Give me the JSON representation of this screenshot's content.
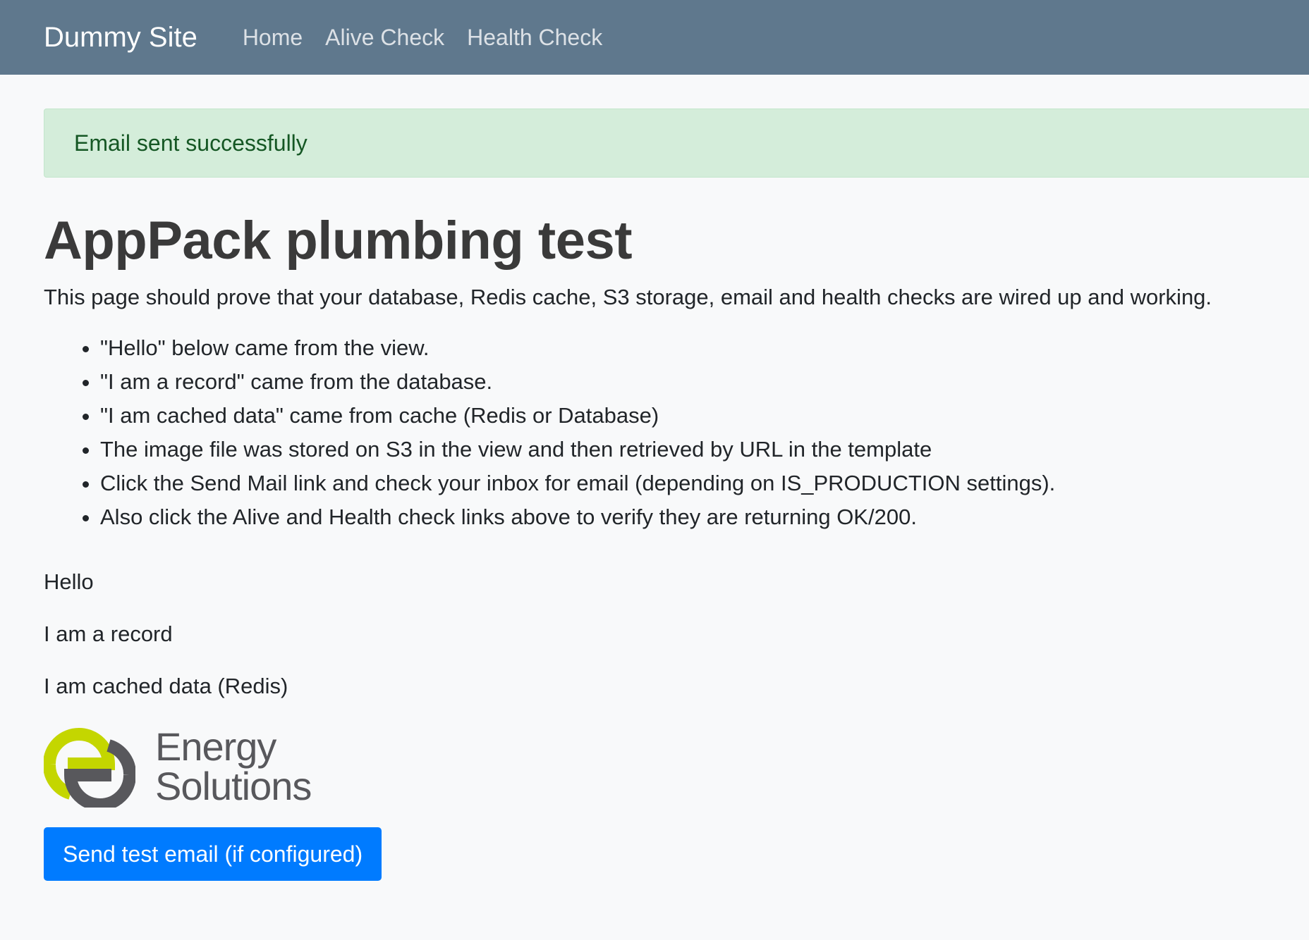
{
  "navbar": {
    "brand": "Dummy Site",
    "links": [
      {
        "label": "Home"
      },
      {
        "label": "Alive Check"
      },
      {
        "label": "Health Check"
      }
    ]
  },
  "alert": {
    "message": "Email sent successfully"
  },
  "main": {
    "title": "AppPack plumbing test",
    "lead": "This page should prove that your database, Redis cache, S3 storage, email and health checks are wired up and working.",
    "notes": [
      "\"Hello\" below came from the view.",
      "\"I am a record\" came from the database.",
      "\"I am cached data\" came from cache (Redis or Database)",
      "The image file was stored on S3 in the view and then retrieved by URL in the template",
      "Click the Send Mail link and check your inbox for email (depending on IS_PRODUCTION settings).",
      "Also click the Alive and Health check links above to verify they are returning OK/200."
    ],
    "hello": "Hello",
    "record": "I am a record",
    "cached": "I am cached data (Redis)",
    "logo": {
      "line1": "Energy",
      "line2": "Solutions"
    },
    "send_button": "Send test email (if configured)"
  },
  "colors": {
    "navbar": "#5f788d",
    "alert_bg": "#d4edda",
    "alert_text": "#155724",
    "button": "#007bff",
    "logo_green": "#c4d600",
    "logo_gray": "#58585c"
  }
}
